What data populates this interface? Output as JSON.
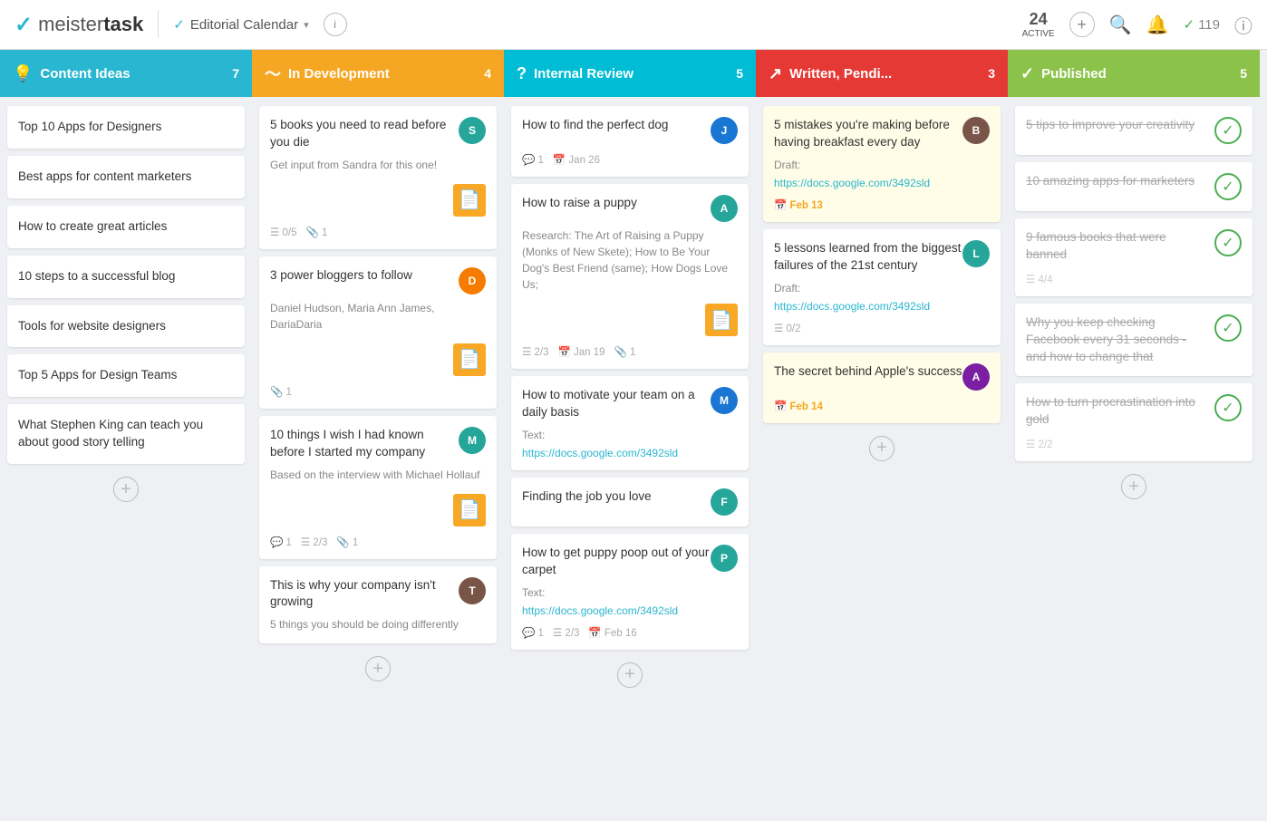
{
  "topbar": {
    "logo_check": "✓",
    "logo_meister": "meister",
    "logo_task": "task",
    "project_check": "✓",
    "project_name": "Editorial Calendar",
    "info_label": "i",
    "active_count": "24",
    "active_label": "ACTIVE",
    "add_icon": "+",
    "search_icon": "🔍",
    "bell_icon": "🔔",
    "completed_check": "✓",
    "completed_count": "119",
    "alert_icon": "ℹ"
  },
  "columns": [
    {
      "id": "content-ideas",
      "color": "blue",
      "icon": "💡",
      "title": "Content Ideas",
      "count": "7",
      "cards": [
        {
          "id": "ci1",
          "title": "Top 10 Apps for Designers",
          "type": "simple"
        },
        {
          "id": "ci2",
          "title": "Best apps for content marketers",
          "type": "simple"
        },
        {
          "id": "ci3",
          "title": "How to create great articles",
          "type": "simple"
        },
        {
          "id": "ci4",
          "title": "10 steps to a successful blog",
          "type": "simple"
        },
        {
          "id": "ci5",
          "title": "Tools for website designers",
          "type": "simple"
        },
        {
          "id": "ci6",
          "title": "Top 5 Apps for Design Teams",
          "type": "simple"
        },
        {
          "id": "ci7",
          "title": "What Stephen King can teach you about good story telling",
          "type": "simple"
        }
      ]
    },
    {
      "id": "in-development",
      "color": "orange",
      "icon": "〜",
      "title": "In Development",
      "count": "4",
      "cards": [
        {
          "id": "id1",
          "title": "5 books you need to read before you die",
          "desc": "Get input from Sandra for this one!",
          "has_doc": true,
          "meta": {
            "checklist": "0/5",
            "attach": "1"
          },
          "avatar": "teal",
          "avatar_text": "S"
        },
        {
          "id": "id2",
          "title": "3 power bloggers to follow",
          "desc": "Daniel Hudson, Maria Ann James, DariaDaria",
          "has_doc": true,
          "meta": {
            "attach": "1"
          },
          "avatar": "orange",
          "avatar_text": "D"
        },
        {
          "id": "id3",
          "title": "10 things I wish I had known before I started my company",
          "desc": "Based on the interview with Michael Hollauf",
          "has_doc": true,
          "meta": {
            "comment": "1",
            "checklist": "2/3",
            "attach": "1"
          },
          "avatar": "teal",
          "avatar_text": "M"
        },
        {
          "id": "id4",
          "title": "This is why your company isn't growing",
          "desc": "5 things you should be doing differently",
          "has_doc": false,
          "meta": {},
          "avatar": "brown",
          "avatar_text": "T"
        }
      ]
    },
    {
      "id": "internal-review",
      "color": "teal",
      "icon": "?",
      "title": "Internal Review",
      "count": "5",
      "cards": [
        {
          "id": "ir1",
          "title": "How to find the perfect dog",
          "meta": {
            "comment": "1",
            "date": "Jan 26"
          },
          "avatar": "blue",
          "avatar_text": "J"
        },
        {
          "id": "ir2",
          "title": "How to raise a puppy",
          "desc": "Research: The Art of Raising a Puppy (Monks of New Skete); How to Be Your Dog's Best Friend (same); How Dogs Love Us;",
          "has_doc": true,
          "meta": {
            "checklist": "2/3",
            "date": "Jan 19",
            "attach": "1"
          },
          "avatar": "teal",
          "avatar_text": "A"
        },
        {
          "id": "ir3",
          "title": "How to motivate your team on a daily basis",
          "desc_label": "Text:",
          "link": "https://docs.google.com/3492sld",
          "avatar": "blue",
          "avatar_text": "M"
        },
        {
          "id": "ir4",
          "title": "Finding the job you love",
          "avatar": "teal",
          "avatar_text": "F"
        },
        {
          "id": "ir5",
          "title": "How to get puppy poop out of your carpet",
          "desc_label": "Text:",
          "link": "https://docs.google.com/3492sld",
          "meta": {
            "comment": "1",
            "checklist": "2/3",
            "date": "Feb 16"
          },
          "avatar": "teal",
          "avatar_text": "P"
        }
      ]
    },
    {
      "id": "written-pending",
      "color": "red",
      "icon": "↗",
      "title": "Written, Pendi...",
      "count": "3",
      "cards": [
        {
          "id": "wp1",
          "title": "5 mistakes you're making before having breakfast every day",
          "desc_label": "Draft:",
          "link": "https://docs.google.com/3492sld",
          "date": "Feb 13",
          "highlight": true,
          "avatar": "brown",
          "avatar_text": "B"
        },
        {
          "id": "wp2",
          "title": "5 lessons learned from the biggest failures of the 21st century",
          "desc_label": "Draft:",
          "link": "https://docs.google.com/3492sld",
          "meta": {
            "checklist": "0/2"
          },
          "highlight": false,
          "avatar": "teal",
          "avatar_text": "L"
        },
        {
          "id": "wp3",
          "title": "The secret behind Apple's success",
          "date": "Feb 14",
          "highlight": true,
          "avatar": "purple",
          "avatar_text": "A"
        }
      ]
    },
    {
      "id": "published",
      "color": "green",
      "icon": "✓",
      "title": "Published",
      "count": "5",
      "cards": [
        {
          "id": "pub1",
          "title": "5 tips to improve your creativity",
          "done": true
        },
        {
          "id": "pub2",
          "title": "10 amazing apps for marketers",
          "done": true
        },
        {
          "id": "pub3",
          "title": "9 famous books that were banned",
          "done": true,
          "meta": {
            "checklist": "4/4"
          }
        },
        {
          "id": "pub4",
          "title": "Why you keep checking Facebook every 31 seconds - and how to change that",
          "done": true
        },
        {
          "id": "pub5",
          "title": "How to turn procrastination into gold",
          "done": true,
          "meta": {
            "checklist": "2/2"
          }
        }
      ]
    }
  ]
}
